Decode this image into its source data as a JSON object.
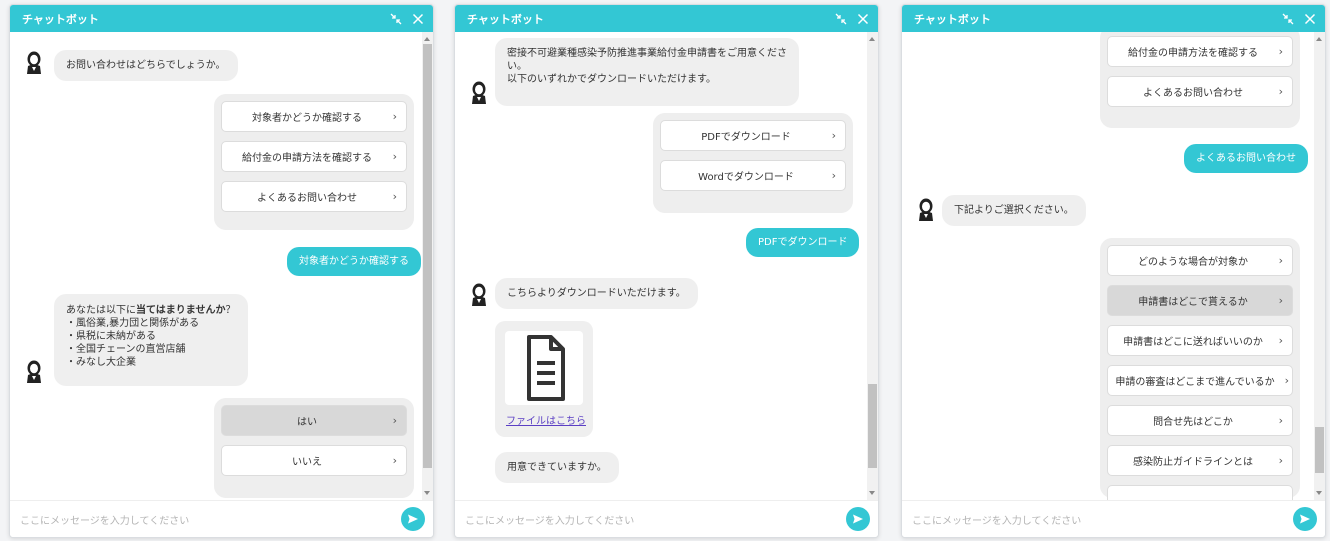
{
  "panels": [
    {
      "title": "チャットボット",
      "input_placeholder": "ここにメッセージを入力してください",
      "bot_question": "お問い合わせはどちらでしょうか。",
      "options1": [
        {
          "label": "対象者かどうか確認する"
        },
        {
          "label": "給付金の申請方法を確認する"
        },
        {
          "label": "よくあるお問い合わせ"
        }
      ],
      "user_reply": "対象者かどうか確認する",
      "bot_check_prefix": "あなたは以下に",
      "bot_check_bold": "当てはまりませんか",
      "bot_check_suffix": "？",
      "bot_check_items": [
        "・風俗業,暴力団と関係がある",
        "・県税に未納がある",
        "・全国チェーンの直営店舗",
        "・みなし大企業"
      ],
      "options2": [
        {
          "label": "はい",
          "selected": true
        },
        {
          "label": "いいえ"
        }
      ]
    },
    {
      "title": "チャットボット",
      "input_placeholder": "ここにメッセージを入力してください",
      "bot_doc_line1": "密接不可避業種感染予防推進事業給付金申請書をご用意くださ",
      "bot_doc_line2": "い。",
      "bot_doc_line3": "以下のいずれかでダウンロードいただけます。",
      "options": [
        {
          "label": "PDFでダウンロード"
        },
        {
          "label": "Wordでダウンロード"
        }
      ],
      "user_reply": "PDFでダウンロード",
      "bot_download": "こちらよりダウンロードいただけます。",
      "file_link": "ファイルはこちら",
      "bot_ready": "用意できていますか。"
    },
    {
      "title": "チャットボット",
      "input_placeholder": "ここにメッセージを入力してください",
      "options_top": [
        {
          "label": "給付金の申請方法を確認する"
        },
        {
          "label": "よくあるお問い合わせ"
        }
      ],
      "user_reply": "よくあるお問い合わせ",
      "bot_select": "下記よりご選択ください。",
      "faq_options": [
        {
          "label": "どのような場合が対象か"
        },
        {
          "label": "申請書はどこで貰えるか",
          "selected": true
        },
        {
          "label": "申請書はどこに送ればいいのか"
        },
        {
          "label": "申請の審査はどこまで進んでいるか"
        },
        {
          "label": "問合せ先はどこか"
        },
        {
          "label": "感染防止ガイドラインとは"
        }
      ]
    }
  ],
  "colors": {
    "accent": "#33c7d4",
    "bubble": "#efefef"
  },
  "icons": {
    "minimize": "shrink-icon",
    "close": "close-icon",
    "send": "send-icon",
    "avatar": "avatar-icon",
    "chevron": "chevron-right-icon",
    "document": "document-icon"
  }
}
